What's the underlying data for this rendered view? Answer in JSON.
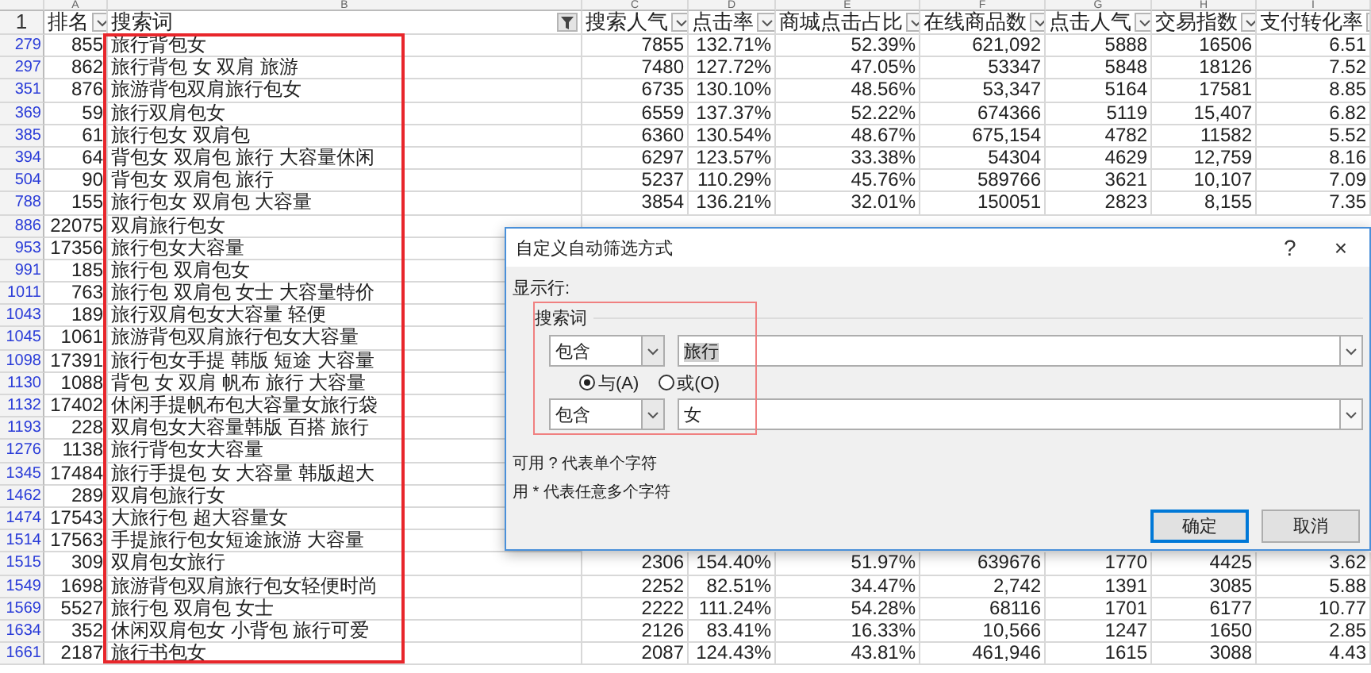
{
  "columns": [
    {
      "letter": "A",
      "label": "排名",
      "filtered": false
    },
    {
      "letter": "B",
      "label": "搜索词",
      "filtered": true
    },
    {
      "letter": "C",
      "label": "搜索人气",
      "filtered": false
    },
    {
      "letter": "D",
      "label": "点击率",
      "filtered": false
    },
    {
      "letter": "E",
      "label": "商城点击占比",
      "filtered": false
    },
    {
      "letter": "F",
      "label": "在线商品数",
      "filtered": false
    },
    {
      "letter": "G",
      "label": "点击人气",
      "filtered": false
    },
    {
      "letter": "H",
      "label": "交易指数",
      "filtered": false
    },
    {
      "letter": "I",
      "label": "支付转化率",
      "filtered": false
    }
  ],
  "header_row": "1",
  "rows": [
    {
      "num": "279",
      "rank": "855",
      "keyword": "旅行背包女",
      "cells": [
        "7855",
        "132.71%",
        "52.39%",
        "621,092",
        "5888",
        "16506",
        "6.51"
      ]
    },
    {
      "num": "297",
      "rank": "862",
      "keyword": "旅行背包 女 双肩 旅游",
      "cells": [
        "7480",
        "127.72%",
        "47.05%",
        "53347",
        "5848",
        "18126",
        "7.52"
      ]
    },
    {
      "num": "351",
      "rank": "876",
      "keyword": "旅游背包双肩旅行包女",
      "cells": [
        "6735",
        "130.10%",
        "48.56%",
        "53,347",
        "5164",
        "17581",
        "8.85"
      ]
    },
    {
      "num": "369",
      "rank": "59",
      "keyword": "旅行双肩包女",
      "cells": [
        "6559",
        "137.37%",
        "52.22%",
        "674366",
        "5119",
        "15,407",
        "6.82"
      ]
    },
    {
      "num": "385",
      "rank": "61",
      "keyword": "旅行包女 双肩包",
      "cells": [
        "6360",
        "130.54%",
        "48.67%",
        "675,154",
        "4782",
        "11582",
        "5.52"
      ]
    },
    {
      "num": "394",
      "rank": "64",
      "keyword": "背包女 双肩包 旅行 大容量休闲",
      "cells": [
        "6297",
        "123.57%",
        "33.38%",
        "54304",
        "4629",
        "12,759",
        "8.16"
      ]
    },
    {
      "num": "504",
      "rank": "90",
      "keyword": "背包女 双肩包 旅行",
      "cells": [
        "5237",
        "110.29%",
        "45.76%",
        "589766",
        "3621",
        "10,107",
        "7.09"
      ]
    },
    {
      "num": "788",
      "rank": "155",
      "keyword": "旅行包女 双肩包 大容量",
      "cells": [
        "3854",
        "136.21%",
        "32.01%",
        "150051",
        "2823",
        "8,155",
        "7.35"
      ]
    },
    {
      "num": "886",
      "rank": "22075",
      "keyword": "双肩旅行包女"
    },
    {
      "num": "953",
      "rank": "17356",
      "keyword": "旅行包女大容量"
    },
    {
      "num": "991",
      "rank": "185",
      "keyword": "旅行包 双肩包女"
    },
    {
      "num": "1011",
      "rank": "763",
      "keyword": "旅行包 双肩包 女士 大容量特价"
    },
    {
      "num": "1043",
      "rank": "189",
      "keyword": "旅行双肩包女大容量 轻便"
    },
    {
      "num": "1045",
      "rank": "1061",
      "keyword": "旅游背包双肩旅行包女大容量"
    },
    {
      "num": "1098",
      "rank": "17391",
      "keyword": "旅行包女手提 韩版 短途 大容量"
    },
    {
      "num": "1130",
      "rank": "1088",
      "keyword": "背包 女 双肩 帆布 旅行 大容量"
    },
    {
      "num": "1132",
      "rank": "17402",
      "keyword": "休闲手提帆布包大容量女旅行袋"
    },
    {
      "num": "1193",
      "rank": "228",
      "keyword": "双肩包女大容量韩版 百搭 旅行"
    },
    {
      "num": "1276",
      "rank": "1138",
      "keyword": "旅行背包女大容量"
    },
    {
      "num": "1345",
      "rank": "17484",
      "keyword": "旅行手提包 女 大容量 韩版超大"
    },
    {
      "num": "1462",
      "rank": "289",
      "keyword": "双肩包旅行女"
    },
    {
      "num": "1474",
      "rank": "17543",
      "keyword": "大旅行包 超大容量女"
    },
    {
      "num": "1514",
      "rank": "17563",
      "keyword": "手提旅行包女短途旅游 大容量"
    },
    {
      "num": "1515",
      "rank": "309",
      "keyword": "双肩包女旅行",
      "cells": [
        "2306",
        "154.40%",
        "51.97%",
        "639676",
        "1770",
        "4425",
        "3.62"
      ]
    },
    {
      "num": "1549",
      "rank": "1698",
      "keyword": "旅游背包双肩旅行包女轻便时尚",
      "cells": [
        "2252",
        "82.51%",
        "34.47%",
        "2,742",
        "1391",
        "3085",
        "5.88"
      ]
    },
    {
      "num": "1569",
      "rank": "5527",
      "keyword": "旅行包 双肩包 女士",
      "cells": [
        "2222",
        "111.24%",
        "54.28%",
        "68116",
        "1701",
        "6177",
        "10.77"
      ]
    },
    {
      "num": "1634",
      "rank": "352",
      "keyword": "休闲双肩包女 小背包 旅行可爱",
      "cells": [
        "2126",
        "83.41%",
        "16.33%",
        "10,566",
        "1247",
        "1650",
        "2.85"
      ]
    },
    {
      "num": "1661",
      "rank": "2187",
      "keyword": "旅行书包女",
      "cells": [
        "2087",
        "124.43%",
        "43.81%",
        "461,946",
        "1615",
        "3088",
        "4.43"
      ]
    }
  ],
  "dialog": {
    "title": "自定义自动筛选方式",
    "help": "?",
    "close": "×",
    "show_rows_label": "显示行:",
    "field_label": "搜索词",
    "conditions": [
      {
        "operator": "包含",
        "value": "旅行",
        "highlighted": true
      },
      {
        "operator": "包含",
        "value": "女",
        "highlighted": false
      }
    ],
    "logic": [
      {
        "label": "与(A)",
        "selected": true
      },
      {
        "label": "或(O)",
        "selected": false
      }
    ],
    "hints": [
      "可用 ? 代表单个字符",
      "用 * 代表任意多个字符"
    ],
    "buttons": [
      {
        "label": "确定",
        "default": true
      },
      {
        "label": "取消",
        "default": false
      }
    ]
  }
}
